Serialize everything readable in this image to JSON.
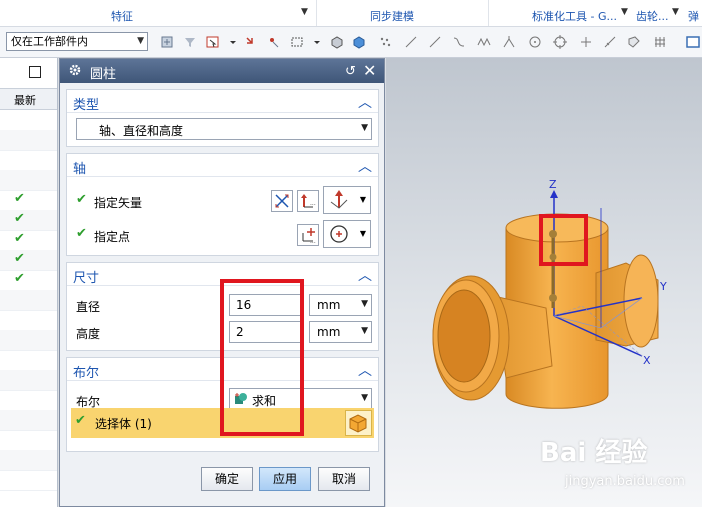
{
  "ribbon": {
    "groups": [
      "特征",
      "同步建模",
      "标准化工具 - G...",
      "齿轮...",
      "弹"
    ]
  },
  "toolbar": {
    "filter_value": "仅在工作部件内",
    "icons": [
      "snap-icon",
      "filter-icon",
      "selection-scope-icon",
      "dropdown-icon",
      "move-icon",
      "select-box-icon",
      "cube-icon",
      "solid-icon",
      "point-icon",
      "line-icon",
      "curve-icon",
      "intersect-icon",
      "arc-icon",
      "circle-center-icon",
      "quadrant-icon",
      "plus-icon",
      "tangent-icon",
      "grid-icon",
      "view-icon"
    ]
  },
  "navigator": {
    "column_header": "最新",
    "checked_rows": 5
  },
  "dialog": {
    "title": "圆柱",
    "sections": {
      "type": {
        "header": "类型",
        "value": "轴、直径和高度"
      },
      "axis": {
        "header": "轴",
        "vector_label": "指定矢量",
        "point_label": "指定点"
      },
      "dimensions": {
        "header": "尺寸",
        "diameter_label": "直径",
        "diameter_value": "16",
        "diameter_unit": "mm",
        "height_label": "高度",
        "height_value": "2",
        "height_unit": "mm"
      },
      "boolean": {
        "header": "布尔",
        "label": "布尔",
        "value": "求和",
        "select_body": "选择体 (1)"
      }
    },
    "buttons": {
      "ok": "确定",
      "apply": "应用",
      "cancel": "取消"
    }
  },
  "viewport": {
    "axes": {
      "z": "Z",
      "y": "Y",
      "x": "X"
    },
    "model_color": "#f0a43c"
  },
  "watermark": {
    "brand": "Bai 经验",
    "url": "jingyan.baidu.com"
  },
  "colors": {
    "accent": "#1e56b0",
    "highlight": "#e0161f",
    "select_row": "#f9d46f"
  }
}
